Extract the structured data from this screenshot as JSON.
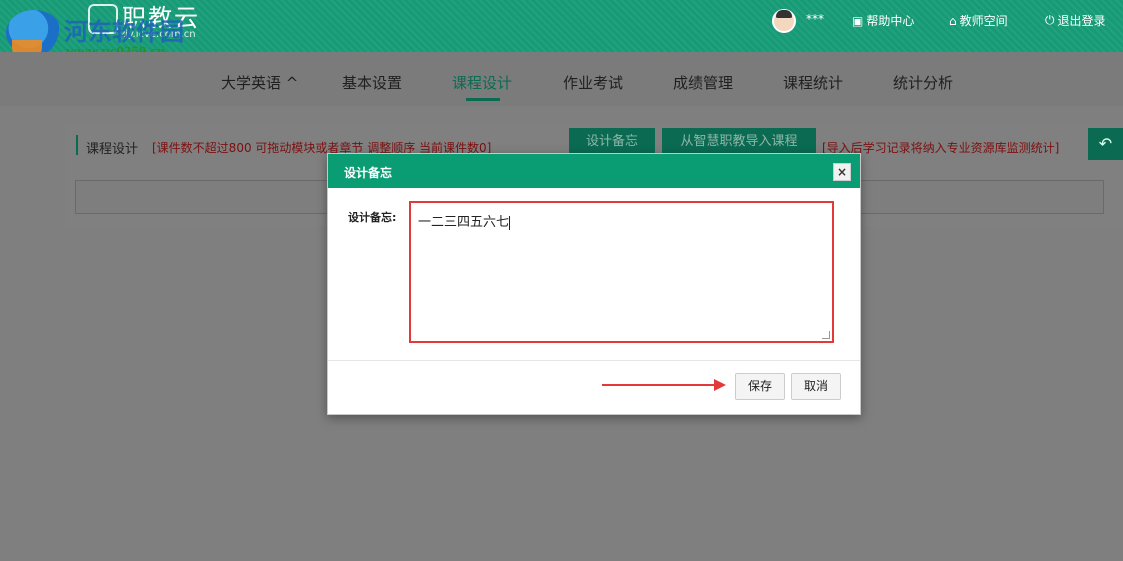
{
  "watermark": {
    "text": "河东软件园",
    "url": "www.pc0359.cn"
  },
  "header": {
    "brand_title": "职教云",
    "brand_domain": "zjy.icve.com.cn",
    "user_name": "***",
    "links": [
      {
        "label": "帮助中心",
        "icon": "help-document-icon"
      },
      {
        "label": "教师空间",
        "icon": "home-icon"
      },
      {
        "label": "退出登录",
        "icon": "power-icon"
      }
    ]
  },
  "nav": {
    "course": "大学英语 ^",
    "items": [
      "基本设置",
      "课程设计",
      "作业考试",
      "成绩管理",
      "课程统计",
      "统计分析"
    ],
    "active_index": 1
  },
  "panel": {
    "title": "课程设计",
    "note": "[课件数不超过800 可拖动模块或者章节 调整顺序 当前课件数0]",
    "button_memo": "设计备忘",
    "button_import": "从智慧职教导入课程",
    "note2": "[导入后学习记录将纳入专业资源库监测统计]",
    "back_icon": "back-arrow-icon"
  },
  "modal": {
    "title": "设计备忘",
    "close_label": "×",
    "field_label": "设计备忘:",
    "textarea_value": "一二三四五六七",
    "save_label": "保存",
    "cancel_label": "取消"
  },
  "colors": {
    "header_green": "#179b76",
    "modal_header": "#0a9d74",
    "highlight_red": "#e3393b",
    "overlay_gray": "#7f7f7f"
  }
}
